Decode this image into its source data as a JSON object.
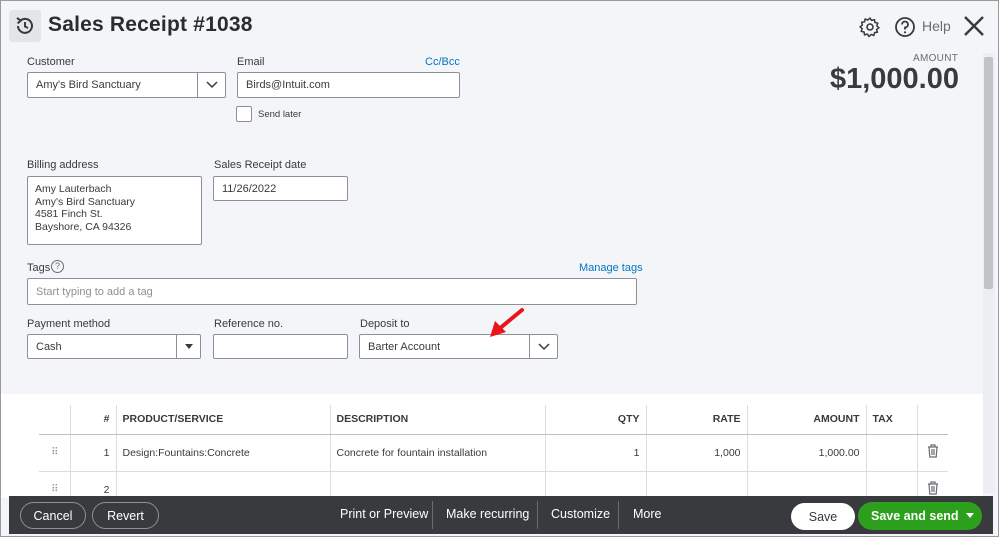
{
  "header": {
    "title": "Sales Receipt #1038",
    "help_label": "Help"
  },
  "form": {
    "customer_label": "Customer",
    "customer_value": "Amy's Bird Sanctuary",
    "email_label": "Email",
    "email_value": "Birds@Intuit.com",
    "ccbcc_link": "Cc/Bcc",
    "send_later_label": "Send later",
    "amount_label": "AMOUNT",
    "amount_value": "$1,000.00",
    "billing_label": "Billing address",
    "billing_lines": [
      "Amy Lauterbach",
      "Amy's Bird Sanctuary",
      "4581 Finch St.",
      "Bayshore, CA  94326"
    ],
    "date_label": "Sales Receipt date",
    "date_value": "11/26/2022",
    "tags_label": "Tags",
    "manage_tags_link": "Manage tags",
    "tags_placeholder": "Start typing to add a tag",
    "payment_label": "Payment method",
    "payment_value": "Cash",
    "reference_label": "Reference no.",
    "reference_value": "",
    "deposit_label": "Deposit to",
    "deposit_value": "Barter Account"
  },
  "table": {
    "headers": [
      "",
      "#",
      "PRODUCT/SERVICE",
      "DESCRIPTION",
      "QTY",
      "RATE",
      "AMOUNT",
      "TAX",
      ""
    ],
    "rows": [
      {
        "num": "1",
        "product": "Design:Fountains:Concrete",
        "description": "Concrete for fountain installation",
        "qty": "1",
        "rate": "1,000",
        "amount": "1,000.00",
        "tax": ""
      },
      {
        "num": "2",
        "product": "",
        "description": "",
        "qty": "",
        "rate": "",
        "amount": "",
        "tax": ""
      }
    ]
  },
  "footer": {
    "cancel": "Cancel",
    "revert": "Revert",
    "print_preview": "Print or Preview",
    "make_recurring": "Make recurring",
    "customize": "Customize",
    "more": "More",
    "save": "Save",
    "save_and_send": "Save and send"
  },
  "colors": {
    "accent_green": "#2ca01c",
    "link_blue": "#0077c5",
    "footer_bg": "#393a3d",
    "arrow_red": "#e8161b"
  }
}
